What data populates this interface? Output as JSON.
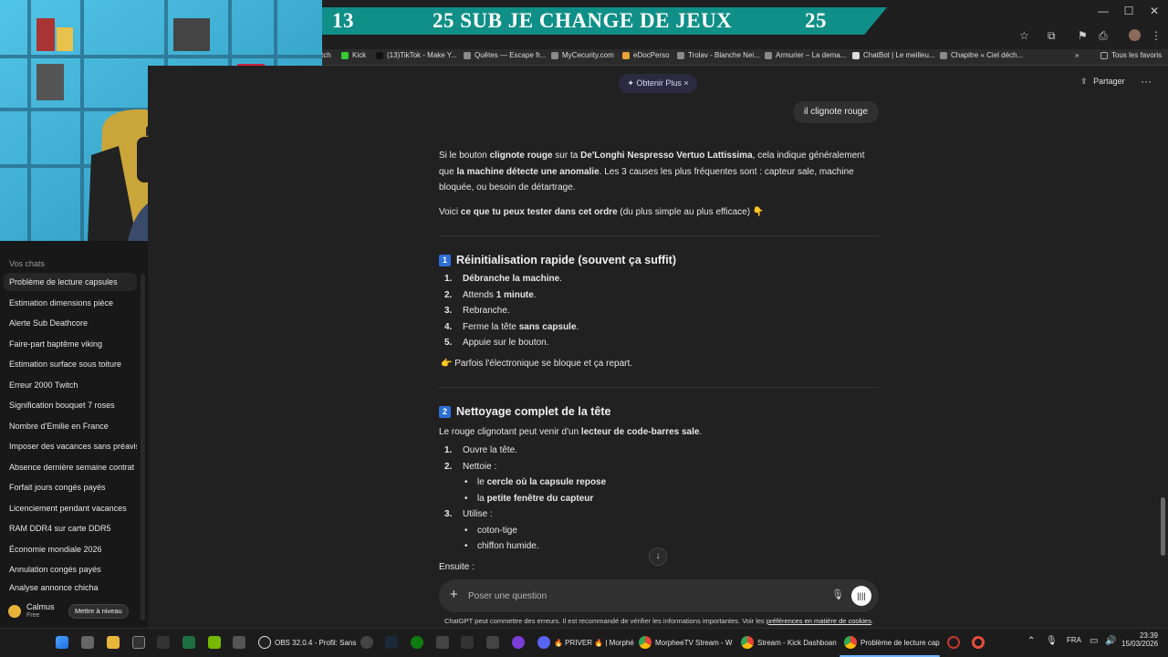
{
  "banner": {
    "left_num": "13",
    "text": "25 SUB JE CHANGE DE JEUX",
    "right_num": "25"
  },
  "window": {
    "minimize": "—",
    "maximize": "☐",
    "close": "✕"
  },
  "bookmarks": [
    "tch",
    "Kick",
    "(13)TikTok - Make Y...",
    "Quêtes — Escape fr...",
    "MyCecurity.com",
    "eDocPerso",
    "Trolav - Blanche Nei...",
    "Armurier – La dema...",
    "ChatBot | Le meilleu...",
    "Chapitre « Ciel déch...",
    "»",
    "Tous les favoris"
  ],
  "sidebar": {
    "heading": "Vos chats",
    "chats": [
      "Problème de lecture capsules",
      "Estimation dimensions pièce",
      "Alerte Sub Deathcore",
      "Faire-part baptême viking",
      "Estimation surface sous toiture",
      "Erreur 2000 Twitch",
      "Signification bouquet 7 roses",
      "Nombre d'Emilie en France",
      "Imposer des vacances sans préavis",
      "Absence dernière semaine contrat",
      "Forfait jours congés payés",
      "Licenciement pendant vacances",
      "RAM DDR4 sur carte DDR5",
      "Économie mondiale 2026",
      "Annulation congés payés",
      "Analyse annonce chicha"
    ],
    "user_name": "Calmus",
    "user_plan": "Free",
    "upgrade": "Mettre à niveau"
  },
  "header": {
    "obtenir": "✦ Obtenir Plus  ×",
    "partager": "Partager",
    "more": "···"
  },
  "user_message": "il clignote rouge",
  "answer": {
    "p1_a": "Si le bouton ",
    "p1_b": "clignote rouge",
    "p1_c": " sur ta ",
    "p1_d": "De'Longhi Nespresso Vertuo Lattissima",
    "p1_e": ", cela indique généralement que ",
    "p1_f": "la machine détecte une anomalie",
    "p1_g": ". Les 3 causes les plus fréquentes sont : capteur sale, machine bloquée, ou besoin de détartrage.",
    "p2_a": "Voici ",
    "p2_b": "ce que tu peux tester dans cet ordre",
    "p2_c": " (du plus simple au plus efficace) 👇",
    "s1_num": "1",
    "s1_title": "Réinitialisation rapide (souvent ça suffit)",
    "s1_items": [
      {
        "n": "1.",
        "bold": "Débranche la machine",
        "rest": "."
      },
      {
        "n": "2.",
        "pre": "Attends ",
        "bold": "1 minute",
        "rest": "."
      },
      {
        "n": "3.",
        "pre": "Rebranche.",
        "bold": "",
        "rest": ""
      },
      {
        "n": "4.",
        "pre": "Ferme la tête ",
        "bold": "sans capsule",
        "rest": "."
      },
      {
        "n": "5.",
        "pre": "Appuie sur le bouton.",
        "bold": "",
        "rest": ""
      }
    ],
    "s1_note": "👉 Parfois l'électronique se bloque et ça repart.",
    "s2_num": "2",
    "s2_title": "Nettoyage complet de la tête",
    "s2_intro_a": "Le rouge clignotant peut venir d'un ",
    "s2_intro_b": "lecteur de code-barres sale",
    "s2_intro_c": ".",
    "s2_items": [
      {
        "n": "1.",
        "text": "Ouvre la tête."
      },
      {
        "n": "2.",
        "text": "Nettoie :"
      },
      {
        "n": "3.",
        "text": "Utilise :"
      }
    ],
    "s2_sub1": [
      {
        "pre": "le ",
        "bold": "cercle où la capsule repose"
      },
      {
        "pre": "la ",
        "bold": "petite fenêtre du capteur"
      }
    ],
    "s2_sub2": [
      "coton-tige",
      "chiffon humide."
    ],
    "ensuite": "Ensuite :"
  },
  "composer": {
    "placeholder": "Poser une question",
    "plus": "+",
    "mic": "🎙",
    "voice": "||||"
  },
  "disclaimer_a": "ChatGPT peut commettre des erreurs. Il est recommandé de vérifier les informations importantes. Voir les ",
  "disclaimer_link": "préférences en matière de cookies",
  "disclaimer_b": ".",
  "taskbar": {
    "apps": [
      "OBS 32.0.4 - Profil: Sans",
      "🔥 PRIVER 🔥 | Morphé",
      "MorpheeTV Stream - W",
      "Stream - Kick Dashboan",
      "Problème de lecture cap"
    ],
    "lang": "FRA",
    "time": "23:39",
    "date": "15/03/2026"
  }
}
